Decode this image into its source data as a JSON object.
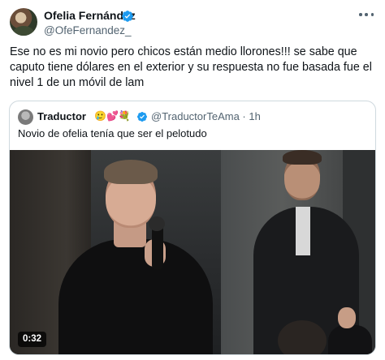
{
  "tweet": {
    "author_name": "Ofelia Fernández",
    "author_handle": "@OfeFernandez_",
    "text": "Ese no es mi novio pero chicos están medio llorones!!! se sabe que caputo tiene dólares en el exterior y su respuesta no fue basada fue el nivel 1 de un móvil de lam"
  },
  "quote": {
    "author_name": "Traductor",
    "emojis": "🥲💕💐",
    "handle_time": "@TraductorTeAma · 1h",
    "text": "Novio de ofelia tenía que ser el pelotudo",
    "video_duration": "0:32"
  },
  "colors": {
    "verified": "#1d9bf0",
    "secondary_text": "#536471",
    "border": "#cfd9de"
  }
}
